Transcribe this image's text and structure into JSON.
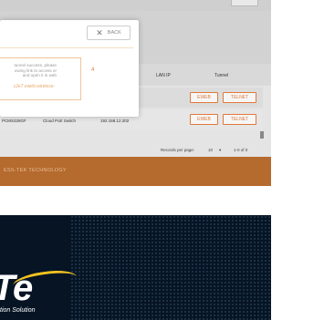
{
  "modal": {
    "back_label": "BACK",
    "step_number": "4",
    "message": "tunnel success, please\nowing link to access or\nand open it in web",
    "link_text": "c2e7.eweb.wireless-"
  },
  "table": {
    "headers": [
      "LAN IP",
      "Tunnel"
    ],
    "rows": [
      {
        "model": "PCMS328GF",
        "type": "Cloud PoE Switch",
        "ip": "192.168.12.202",
        "eweb": "EWEB",
        "telnet": "TELNET"
      }
    ],
    "row1_buttons": {
      "eweb": "EWEB",
      "telnet": "TELNET"
    },
    "pager": {
      "label": "Records per page:",
      "per_page": "10",
      "range": "1-0 of 0"
    }
  },
  "footer": {
    "text": "ESS-TEK TECHNOLOGY"
  },
  "banner": {
    "logo_text": "Te",
    "tagline": "tion Solution"
  },
  "colors": {
    "accent": "#e07a3a",
    "footer": "#b56a2e",
    "banner_bg": "#061424",
    "swoosh": "#f4c320"
  }
}
